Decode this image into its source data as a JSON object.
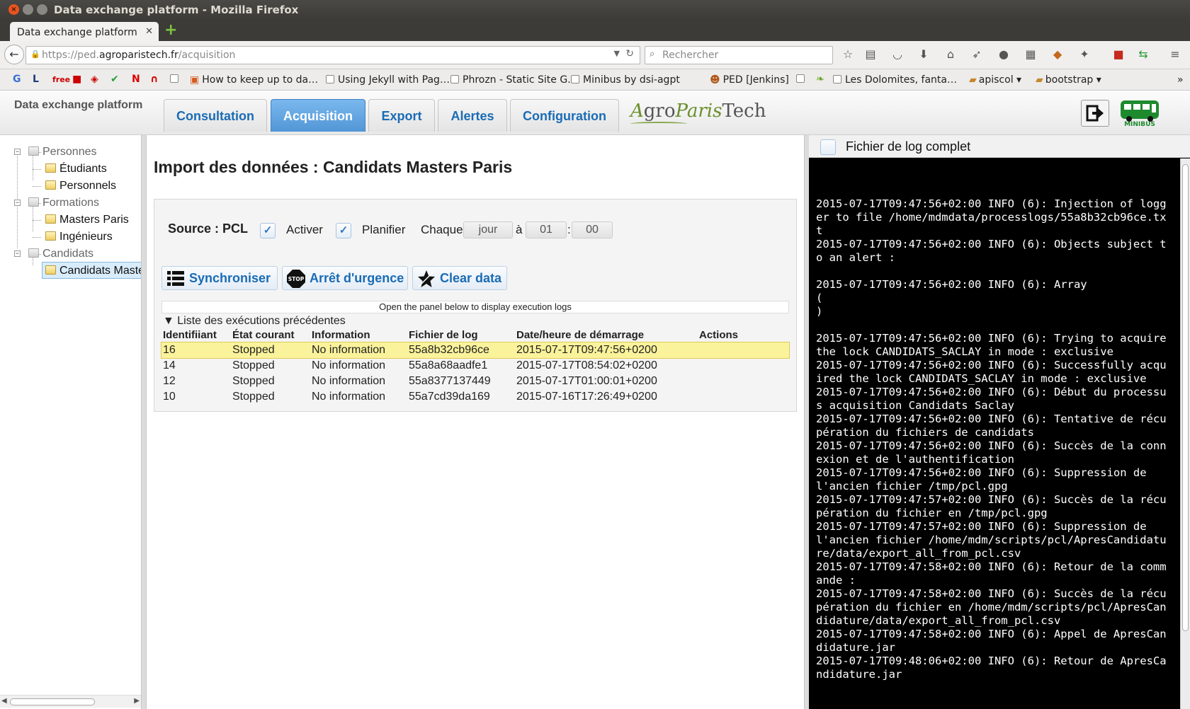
{
  "window": {
    "title": "Data exchange platform - Mozilla Firefox"
  },
  "browser": {
    "tab_label": "Data exchange platform",
    "url_prefix": "https://ped.",
    "url_host": "agroparistech.fr",
    "url_path": "/acquisition",
    "search_placeholder": "Rechercher"
  },
  "bookmarks": [
    "How to keep up to da…",
    "Using Jekyll with Pag…",
    "Phrozn - Static Site G…",
    "Minibus by dsi-agpt",
    "PED [Jenkins]",
    "Les Dolomites, fanta…",
    "apiscol",
    "bootstrap"
  ],
  "app": {
    "title": "Data exchange platform",
    "tabs": [
      "Consultation",
      "Acquisition",
      "Export",
      "Alertes",
      "Configuration"
    ],
    "active_tab": "Acquisition",
    "logo_a": "A",
    "logo_gro": "gro",
    "logo_paris": "Paris",
    "logo_tech": "Tech",
    "minibus_label": "MINIBUS"
  },
  "tree": {
    "personnes": "Personnes",
    "etudiants": "Étudiants",
    "personnels": "Personnels",
    "formations": "Formations",
    "masters": "Masters Paris",
    "ingenieurs": "Ingénieurs",
    "candidats": "Candidats",
    "candidats_masters": "Candidats Masters Paris"
  },
  "main": {
    "title": "Import des données : Candidats Masters Paris",
    "source_label": "Source : PCL",
    "activer_label": "Activer",
    "planifier_label": "Planifier",
    "chaque_label": "Chaque",
    "period_value": "jour",
    "a_label": "à",
    "hour_value": "01",
    "colon": ":",
    "minute_value": "00",
    "btn_sync": "Synchroniser",
    "btn_stop": "Arrêt d'urgence",
    "btn_clear": "Clear data",
    "stop_icon_text": "STOP",
    "hint": "Open the panel below to display execution logs",
    "list_toggle": "▼ Liste des exécutions précédentes",
    "columns": [
      "Identifiiant",
      "État courant",
      "Information",
      "Fichier de log",
      "Date/heure de démarrage",
      "Actions"
    ],
    "rows": [
      [
        "16",
        "Stopped",
        "No information",
        "55a8b32cb96ce",
        "2015-07-17T09:47:56+0200",
        ""
      ],
      [
        "14",
        "Stopped",
        "No information",
        "55a8a68aadfe1",
        "2015-07-17T08:54:02+0200",
        ""
      ],
      [
        "12",
        "Stopped",
        "No information",
        "55a8377137449",
        "2015-07-17T01:00:01+0200",
        ""
      ],
      [
        "10",
        "Stopped",
        "No information",
        "55a7cd39da169",
        "2015-07-16T17:26:49+0200",
        ""
      ]
    ]
  },
  "log": {
    "header": "Fichier de log complet",
    "text": "2015-07-17T09:47:56+02:00 INFO (6): Injection of logger to file /home/mdmdata/processlogs/55a8b32cb96ce.txt\n2015-07-17T09:47:56+02:00 INFO (6): Objects subject to an alert :\n\n2015-07-17T09:47:56+02:00 INFO (6): Array\n(\n)\n\n2015-07-17T09:47:56+02:00 INFO (6): Trying to acquire the lock CANDIDATS_SACLAY in mode : exclusive\n2015-07-17T09:47:56+02:00 INFO (6): Successfully acquired the lock CANDIDATS_SACLAY in mode : exclusive\n2015-07-17T09:47:56+02:00 INFO (6): Début du processus acquisition Candidats Saclay\n2015-07-17T09:47:56+02:00 INFO (6): Tentative de récupération du fichiers de candidats\n2015-07-17T09:47:56+02:00 INFO (6): Succès de la connexion et de l'authentification\n2015-07-17T09:47:56+02:00 INFO (6): Suppression de l'ancien fichier /tmp/pcl.gpg\n2015-07-17T09:47:57+02:00 INFO (6): Succès de la récupération du fichier en /tmp/pcl.gpg\n2015-07-17T09:47:57+02:00 INFO (6): Suppression de l'ancien fichier /home/mdm/scripts/pcl/ApresCandidature/data/export_all_from_pcl.csv\n2015-07-17T09:47:58+02:00 INFO (6): Retour de la commande :\n2015-07-17T09:47:58+02:00 INFO (6): Succès de la récupération du fichier en /home/mdm/scripts/pcl/ApresCandidature/data/export_all_from_pcl.csv\n2015-07-17T09:47:58+02:00 INFO (6): Appel de ApresCandidature.jar\n2015-07-17T09:48:06+02:00 INFO (6): Retour de ApresCandidature.jar"
  }
}
